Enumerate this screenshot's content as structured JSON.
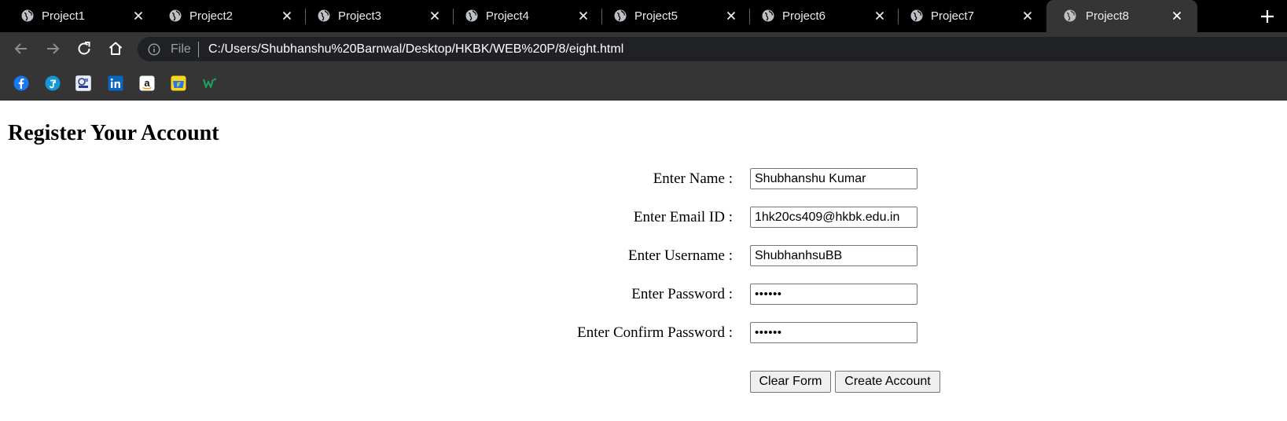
{
  "browser": {
    "tabs": [
      {
        "title": "Project1",
        "active": false
      },
      {
        "title": "Project2",
        "active": false
      },
      {
        "title": "Project3",
        "active": false
      },
      {
        "title": "Project4",
        "active": false
      },
      {
        "title": "Project5",
        "active": false
      },
      {
        "title": "Project6",
        "active": false
      },
      {
        "title": "Project7",
        "active": false
      },
      {
        "title": "Project8",
        "active": true
      }
    ],
    "address": {
      "scheme_label": "File",
      "url": "C:/Users/Shubhanshu%20Barnwal/Desktop/HKBK/WEB%20P/8/eight.html"
    },
    "bookmarks": [
      {
        "icon": "facebook-icon",
        "color": "#1877f2"
      },
      {
        "icon": "jiosaavn-icon",
        "color": "#1497d8"
      },
      {
        "icon": "portal-icon",
        "color": "#2b3a8c"
      },
      {
        "icon": "linkedin-icon",
        "color": "#0a66c2"
      },
      {
        "icon": "amazon-icon",
        "color": "#ffffff"
      },
      {
        "icon": "flipkart-icon",
        "color": "#f8d71b"
      },
      {
        "icon": "w-icon",
        "color": "#1e9e5a"
      }
    ]
  },
  "page": {
    "heading": "Register Your Account",
    "form": {
      "fields": [
        {
          "label": "Enter Name :",
          "value": "Shubhanshu Kumar",
          "type": "text"
        },
        {
          "label": "Enter Email ID :",
          "value": "1hk20cs409@hkbk.edu.in",
          "type": "email"
        },
        {
          "label": "Enter Username :",
          "value": "ShubhanhsuBB",
          "type": "text"
        },
        {
          "label": "Enter Password :",
          "value": "••••••",
          "type": "password"
        },
        {
          "label": "Enter Confirm Password :",
          "value": "••••••",
          "type": "password"
        }
      ],
      "clear_label": "Clear Form",
      "submit_label": "Create Account"
    }
  }
}
